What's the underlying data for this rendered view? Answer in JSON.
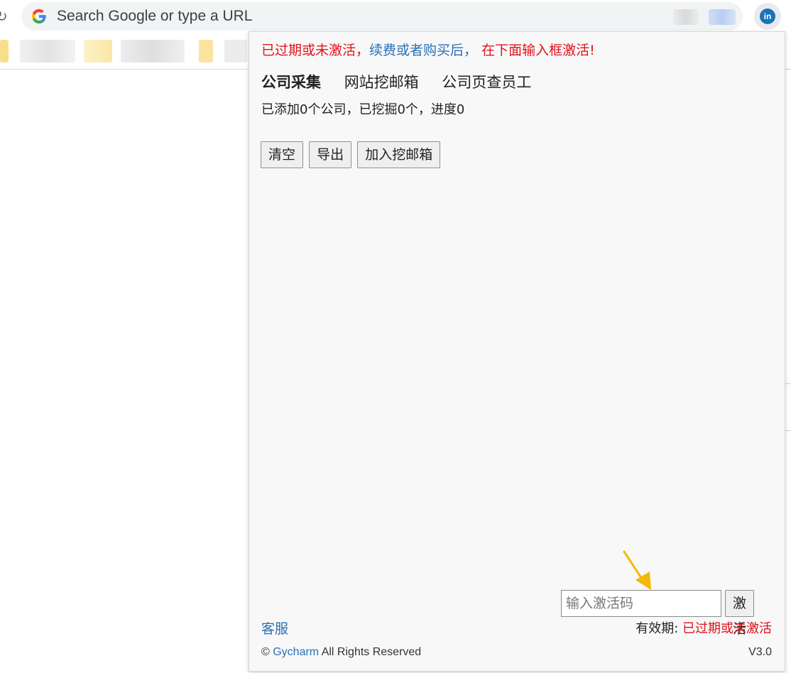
{
  "browser": {
    "omnibox_placeholder": "Search Google or type a URL",
    "extension_icon_label": "in",
    "reload_glyph": "↻"
  },
  "popup": {
    "notice": {
      "part1": "已过期或未激活，",
      "part2": "续费或者购买后，",
      "part3": " 在下面输入框激活!"
    },
    "tabs": [
      {
        "label": "公司采集",
        "active": true
      },
      {
        "label": "网站挖邮箱",
        "active": false
      },
      {
        "label": "公司页查员工",
        "active": false
      }
    ],
    "progress_text": "已添加0个公司，已挖掘0个，进度0",
    "buttons": {
      "clear": "清空",
      "export": "导出",
      "add_to_mining": "加入挖邮箱"
    },
    "activation": {
      "placeholder": "输入激活码",
      "button_label": "激活"
    },
    "support_label": "客服",
    "validity": {
      "label": "有效期: ",
      "status": "已过期或未激活"
    },
    "footer": {
      "copyright": "© ",
      "brand": "Gycharm",
      "rights": " All Rights Reserved",
      "version": "V3.0"
    }
  },
  "colors": {
    "warning_red": "#e0121b",
    "link_blue": "#2a70b5",
    "arrow_orange": "#f5b70a",
    "popup_bg": "#f8f8f8"
  }
}
